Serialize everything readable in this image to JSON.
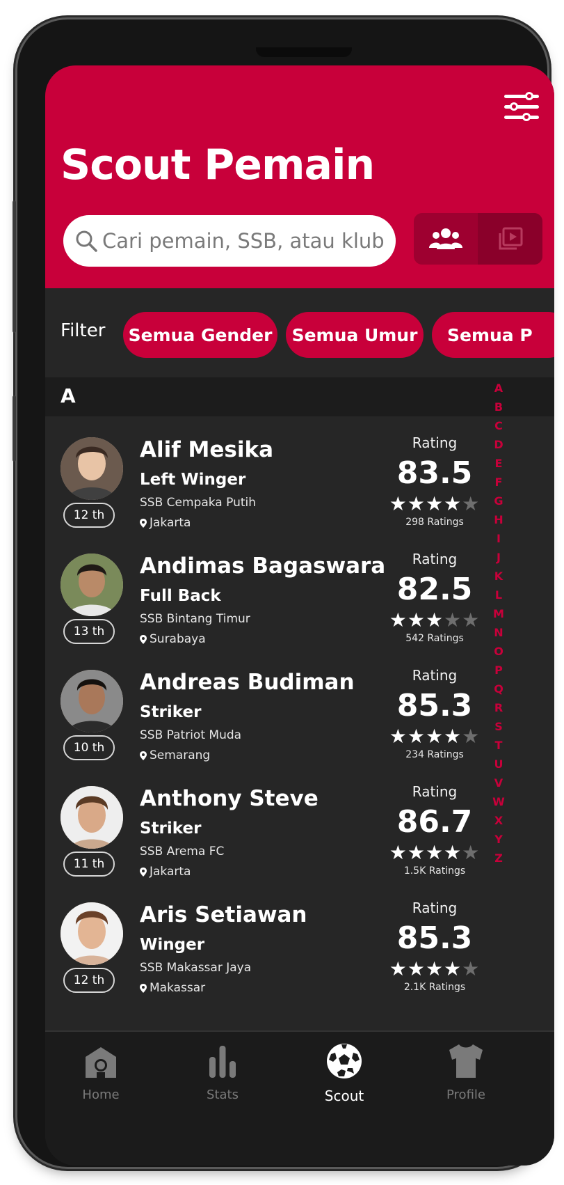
{
  "header": {
    "title": "Scout Pemain",
    "search_placeholder": "Cari pemain, SSB, atau klub",
    "menu_icon": "sliders-icon",
    "view_toggle": [
      {
        "icon": "group-icon",
        "active": true
      },
      {
        "icon": "video-gallery-icon",
        "active": false
      }
    ]
  },
  "filter": {
    "label": "Filter",
    "chips": [
      "Semua Gender",
      "Semua Umur",
      "Semua P"
    ]
  },
  "section": {
    "letter": "A"
  },
  "players": [
    {
      "name": "Alif Mesika",
      "position": "Left Winger",
      "club": "SSB Cempaka Putih",
      "city": "Jakarta",
      "age": "12 th",
      "rating_label": "Rating",
      "rating": "83.5",
      "stars": 4,
      "ratings_count": "298 Ratings"
    },
    {
      "name": "Andimas Bagaswara",
      "position": "Full Back",
      "club": "SSB Bintang Timur",
      "city": "Surabaya",
      "age": "13 th",
      "rating_label": "Rating",
      "rating": "82.5",
      "stars": 3,
      "ratings_count": "542 Ratings"
    },
    {
      "name": "Andreas Budiman",
      "position": "Striker",
      "club": "SSB Patriot Muda",
      "city": "Semarang",
      "age": "10 th",
      "rating_label": "Rating",
      "rating": "85.3",
      "stars": 4,
      "ratings_count": "234 Ratings"
    },
    {
      "name": "Anthony Steve",
      "position": "Striker",
      "club": "SSB Arema FC",
      "city": "Jakarta",
      "age": "11 th",
      "rating_label": "Rating",
      "rating": "86.7",
      "stars": 4,
      "ratings_count": "1.5K Ratings"
    },
    {
      "name": "Aris Setiawan",
      "position": "Winger",
      "club": "SSB Makassar Jaya",
      "city": "Makassar",
      "age": "12 th",
      "rating_label": "Rating",
      "rating": "85.3",
      "stars": 4,
      "ratings_count": "2.1K Ratings"
    }
  ],
  "alphabet": [
    "A",
    "B",
    "C",
    "D",
    "E",
    "F",
    "G",
    "H",
    "I",
    "J",
    "K",
    "L",
    "M",
    "N",
    "O",
    "P",
    "Q",
    "R",
    "S",
    "T",
    "U",
    "V",
    "W",
    "X",
    "Y",
    "Z"
  ],
  "nav": [
    {
      "label": "Home",
      "icon": "stadium-icon",
      "active": false
    },
    {
      "label": "Stats",
      "icon": "bar-chart-icon",
      "active": false
    },
    {
      "label": "Scout",
      "icon": "soccer-ball-icon",
      "active": true
    },
    {
      "label": "Profile",
      "icon": "jersey-icon",
      "active": false
    }
  ],
  "colors": {
    "accent": "#c8003a",
    "background": "#262626",
    "nav_bg": "#1b1b1b"
  }
}
